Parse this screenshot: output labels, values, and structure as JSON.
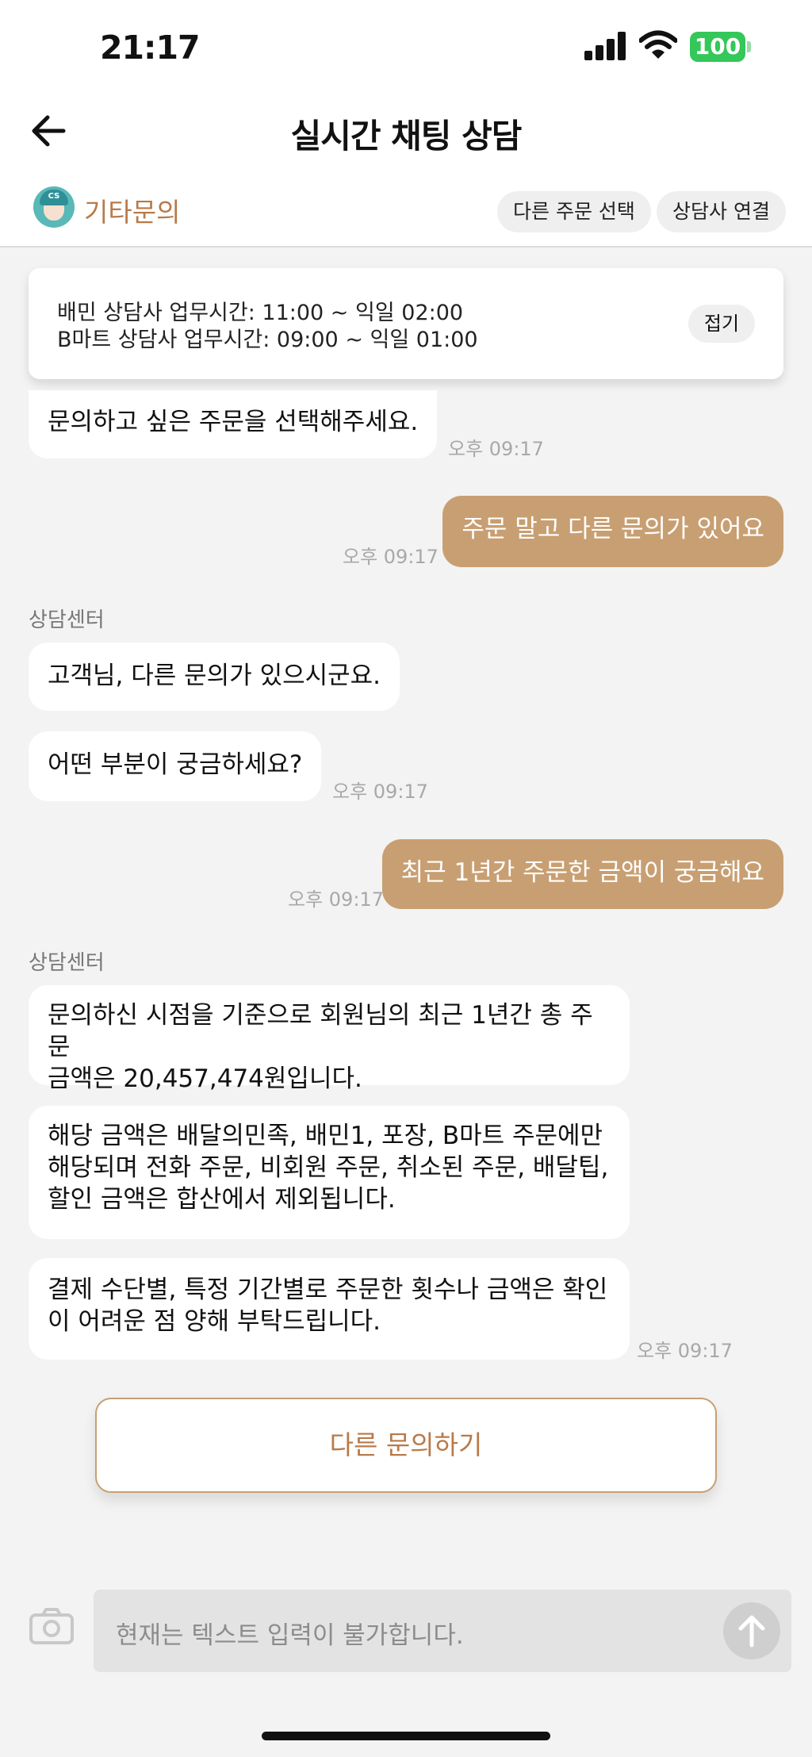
{
  "status_bar": {
    "time": "21:17",
    "battery": "100"
  },
  "header": {
    "title": "실시간 채팅 상담"
  },
  "subbar": {
    "category": "기타문의",
    "avatar_badge": "CS",
    "btn_other_order": "다른 주문 선택",
    "btn_connect_agent": "상담사 연결"
  },
  "notice": {
    "line1": "배민 상담사 업무시간: 11:00 ~ 익일 02:00",
    "line2": "B마트 상담사 업무시간: 09:00 ~ 익일 01:00",
    "fold_label": "접기"
  },
  "messages": [
    {
      "from": "bot",
      "text": "문의하고 싶은 주문을 선택해주세요.",
      "time": "오후 09:17"
    },
    {
      "from": "me",
      "text": "주문 말고 다른 문의가 있어요",
      "time": "오후 09:17"
    },
    {
      "sender": "상담센터"
    },
    {
      "from": "bot",
      "text": "고객님, 다른 문의가 있으시군요."
    },
    {
      "from": "bot",
      "text": "어떤 부분이 궁금하세요?",
      "time": "오후 09:17"
    },
    {
      "from": "me",
      "text": "최근 1년간 주문한 금액이 궁금해요",
      "time": "오후 09:17"
    },
    {
      "sender": "상담센터"
    },
    {
      "from": "bot",
      "lines": [
        "문의하신 시점을 기준으로 회원님의 최근 1년간 총 주문",
        "금액은 20,457,474원입니다."
      ]
    },
    {
      "from": "bot",
      "lines": [
        "해당 금액은 배달의민족, 배민1, 포장, B마트 주문에만",
        "해당되며 전화 주문, 비회원 주문, 취소된 주문, 배달팁,",
        "할인 금액은 합산에서 제외됩니다."
      ]
    },
    {
      "from": "bot",
      "lines": [
        "결제 수단별, 특정 기간별로 주문한 횟수나 금액은 확인",
        "이 어려운 점 양해 부탁드립니다."
      ],
      "time": "오후 09:17"
    }
  ],
  "cta": {
    "label": "다른 문의하기"
  },
  "input": {
    "placeholder": "현재는 텍스트 입력이 불가합니다."
  },
  "colors": {
    "accent": "#c89f72",
    "accent_text": "#b87a4a",
    "background": "#f3f3f3"
  }
}
